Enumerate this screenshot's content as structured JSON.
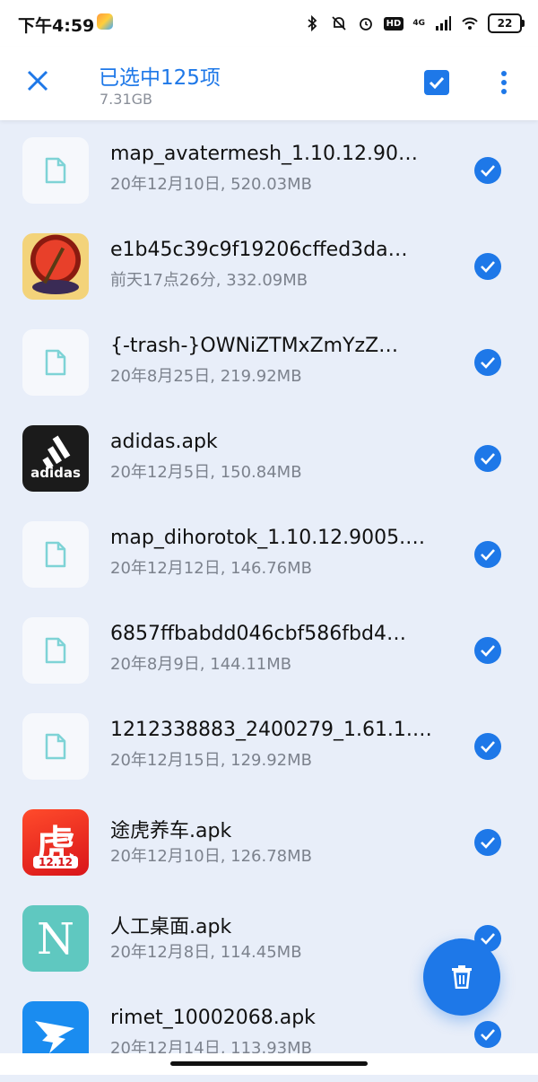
{
  "status_bar": {
    "time": "下午4:59",
    "network_label": "4G",
    "hd_label": "HD",
    "battery": "22"
  },
  "app_bar": {
    "title": "已选中125项",
    "subtitle": "7.31GB",
    "icons": [
      "close-icon",
      "select-all-checkbox-icon",
      "more-vert-icon"
    ]
  },
  "colors": {
    "accent": "#1e78e8",
    "background": "#e8eef9",
    "file_icon": "#7ed3d6"
  },
  "files": [
    {
      "name": "map_avatermesh_1.10.12.90…",
      "meta": "20年12月10日, 520.03MB",
      "thumb": "file-icon",
      "checked": true
    },
    {
      "name": "e1b45c39c9f19206cffed3da…",
      "meta": "前天17点26分, 332.09MB",
      "thumb": "game-app-icon",
      "checked": true
    },
    {
      "name": "{-trash-}OWNiZTMxZmYzZ…",
      "meta": "20年8月25日, 219.92MB",
      "thumb": "file-icon",
      "checked": true
    },
    {
      "name": "adidas.apk",
      "meta": "20年12月5日, 150.84MB",
      "thumb": "adidas-app-icon",
      "thumb_text": "adidas",
      "checked": true
    },
    {
      "name": "map_dihorotok_1.10.12.9005.…",
      "meta": "20年12月12日, 146.76MB",
      "thumb": "file-icon",
      "checked": true
    },
    {
      "name": "6857ffbabdd046cbf586fbd4…",
      "meta": "20年8月9日, 144.11MB",
      "thumb": "file-icon",
      "checked": true
    },
    {
      "name": "1212338883_2400279_1.61.1.…",
      "meta": "20年12月15日, 129.92MB",
      "thumb": "file-icon",
      "checked": true
    },
    {
      "name": "途虎养车.apk",
      "meta": "20年12月10日, 126.78MB",
      "thumb": "tuhu-app-icon",
      "thumb_text": "虎",
      "thumb_sub": "12.12",
      "checked": true
    },
    {
      "name": "人工桌面.apk",
      "meta": "20年12月8日, 114.45MB",
      "thumb": "launcher-app-icon",
      "thumb_text": "N",
      "checked": true
    },
    {
      "name": "rimet_10002068.apk",
      "meta": "20年12月14日, 113.93MB",
      "thumb": "dingtalk-app-icon",
      "checked": true
    }
  ],
  "fab": {
    "icon": "trash-icon"
  }
}
